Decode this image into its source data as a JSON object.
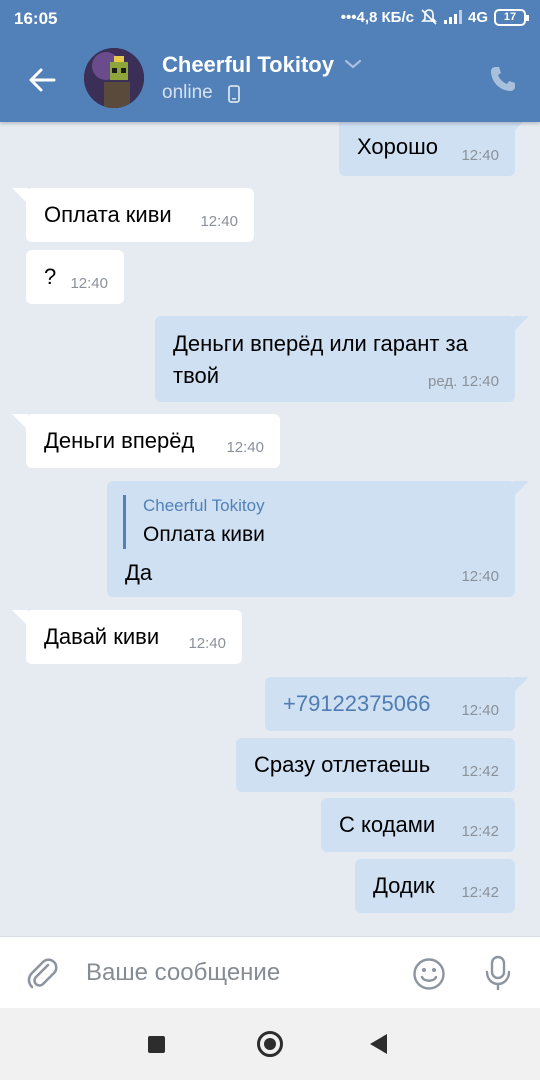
{
  "status_bar": {
    "time": "16:05",
    "speed": "•••4,8 КБ/с",
    "network": "4G",
    "battery": "17"
  },
  "header": {
    "contact_name": "Cheerful Tokitoy",
    "status": "online",
    "back_icon": "arrow-left-icon",
    "call_icon": "phone-icon",
    "accent_color": "#5181b8"
  },
  "messages": [
    {
      "dir": "out",
      "text": "Хорошо",
      "time": "12:40"
    },
    {
      "dir": "in",
      "text": "Оплата киви",
      "time": "12:40"
    },
    {
      "dir": "in",
      "text": "?",
      "time": "12:40"
    },
    {
      "dir": "out",
      "text_line1": "Деньги вперёд или гарант за",
      "text_line2": "твой",
      "time": "ред. 12:40"
    },
    {
      "dir": "in",
      "text": "Деньги вперёд",
      "time": "12:40"
    },
    {
      "dir": "out",
      "reply_author": "Cheerful Tokitoy",
      "reply_text": "Оплата киви",
      "text": "Да",
      "time": "12:40"
    },
    {
      "dir": "in",
      "text": "Давай киви",
      "time": "12:40"
    },
    {
      "dir": "out",
      "text": "+79122375066",
      "time": "12:40",
      "is_link": true
    },
    {
      "dir": "out",
      "text": "Сразу отлетаешь",
      "time": "12:42"
    },
    {
      "dir": "out",
      "text": "С кодами",
      "time": "12:42"
    },
    {
      "dir": "out",
      "text": "Додик",
      "time": "12:42"
    }
  ],
  "composer": {
    "placeholder": "Ваше сообщение"
  }
}
